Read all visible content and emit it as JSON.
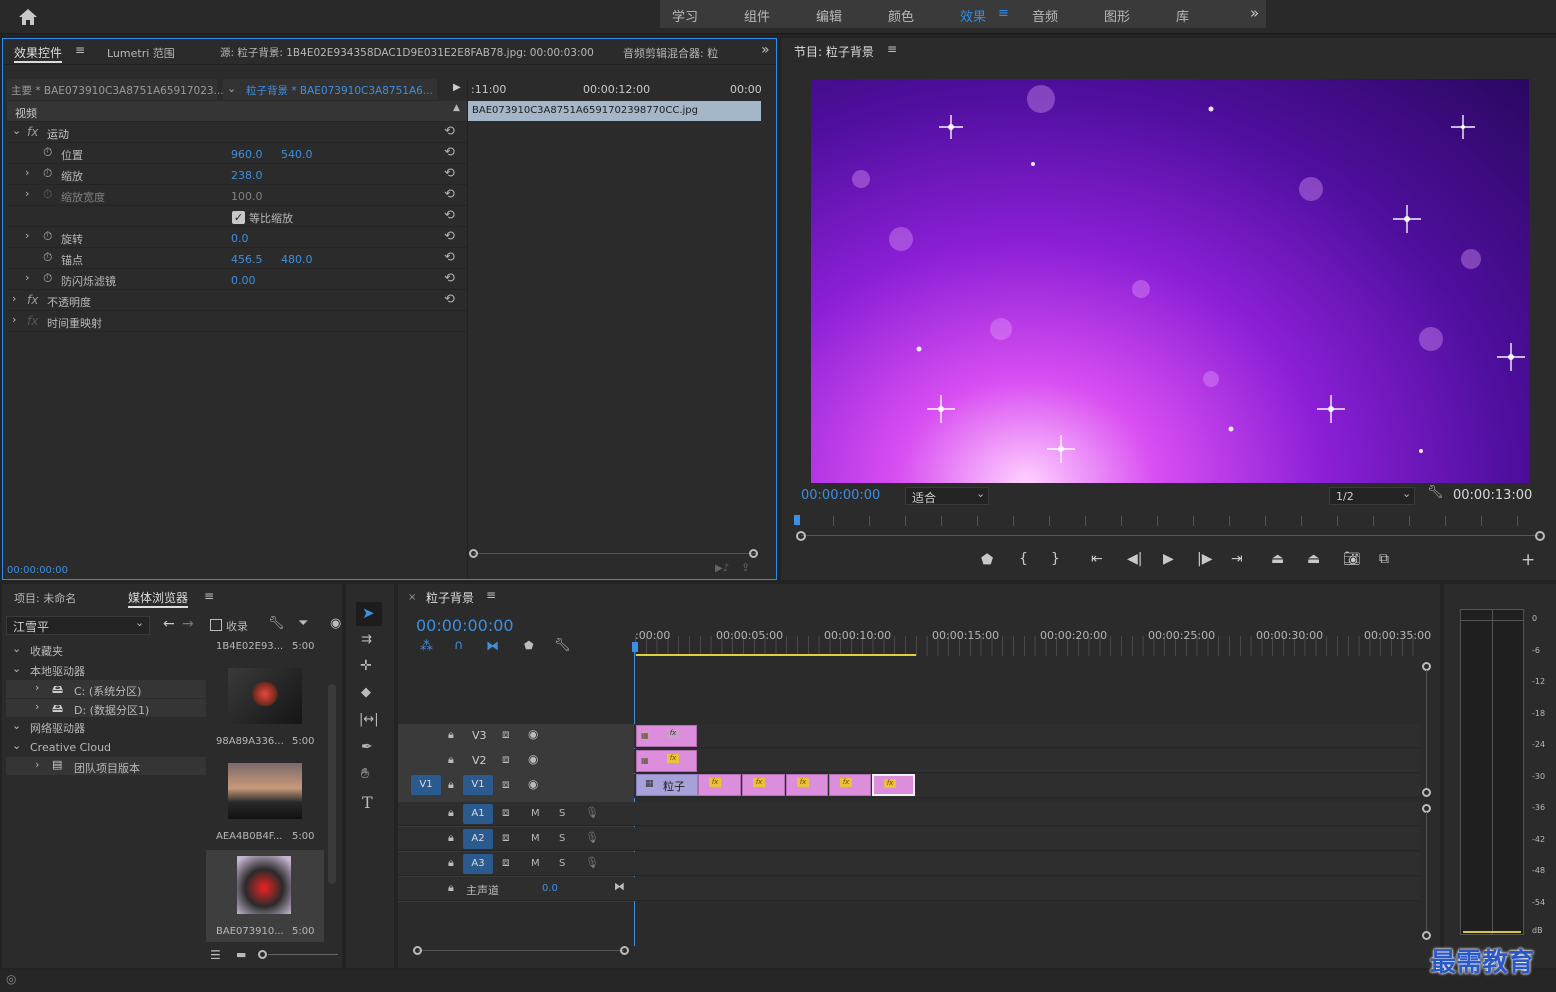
{
  "workspace": {
    "tabs": [
      "学习",
      "组件",
      "编辑",
      "颜色",
      "效果",
      "音频",
      "图形",
      "库"
    ],
    "active": "效果",
    "overflow": "»"
  },
  "effects_panel": {
    "tabs": [
      "效果控件",
      "Lumetri 范围",
      "源: 粒子背景: 1B4E02E934358DAC1D9E031E2E8FAB78.jpg: 00:00:03:00",
      "音频剪辑混合器: 粒"
    ],
    "master_label": "主要 * BAE073910C3A8751A65917023...",
    "sequence_label": "粒子背景 * BAE073910C3A8751A6...",
    "ruler": [
      ":11:00",
      "00:00:12:00",
      "00:00"
    ],
    "clip_name": "BAE073910C3A8751A6591702398770CC.jpg",
    "section": "视频",
    "motion": "运动",
    "props": [
      {
        "label": "位置",
        "v1": "960.0",
        "v2": "540.0"
      },
      {
        "label": "缩放",
        "v1": "238.0",
        "v2": ""
      },
      {
        "label": "缩放宽度",
        "v1": "100.0",
        "v2": ""
      },
      {
        "label": "等比缩放",
        "v1": "",
        "v2": ""
      },
      {
        "label": "旋转",
        "v1": "0.0",
        "v2": ""
      },
      {
        "label": "锚点",
        "v1": "456.5",
        "v2": "480.0"
      },
      {
        "label": "防闪烁滤镜",
        "v1": "0.00",
        "v2": ""
      }
    ],
    "opacity": "不透明度",
    "timeremap": "时间重映射",
    "timecode": "00:00:00:00"
  },
  "program": {
    "title": "节目: 粒子背景",
    "timecode": "00:00:00:00",
    "fit": "适合",
    "resolution": "1/2",
    "duration": "00:00:13:00"
  },
  "project": {
    "tabs": [
      "项目: 未命名",
      "媒体浏览器"
    ],
    "user": "江雪平",
    "fav_checkbox": "收录",
    "tree": [
      "收藏夹",
      "本地驱动器",
      "C: (系统分区)",
      "D: (数据分区1)",
      "网络驱动器",
      "Creative Cloud",
      "团队项目版本"
    ],
    "thumbs": [
      {
        "name": "1B4E02E93...",
        "dur": "5:00"
      },
      {
        "name": "98A89A336...",
        "dur": "5:00"
      },
      {
        "name": "AEA4B0B4F...",
        "dur": "5:00"
      },
      {
        "name": "BAE073910...",
        "dur": "5:00"
      }
    ]
  },
  "timeline": {
    "tab": "粒子背景",
    "timecode": "00:00:00:00",
    "ruler": [
      ":00:00",
      "00:00:05:00",
      "00:00:10:00",
      "00:00:15:00",
      "00:00:20:00",
      "00:00:25:00",
      "00:00:30:00",
      "00:00:35:00"
    ],
    "video_tracks": [
      "V3",
      "V2",
      "V1"
    ],
    "source_patch": "V1",
    "audio_tracks": [
      "A1",
      "A2",
      "A3"
    ],
    "master": "主声道",
    "master_val": "0.0",
    "clip_label": "粒子",
    "m": "M",
    "s": "S"
  },
  "meter": {
    "scale": [
      "0",
      "-6",
      "-12",
      "-18",
      "-24",
      "-30",
      "-36",
      "-42",
      "-48",
      "-54",
      "dB"
    ]
  },
  "watermark": "最需教育"
}
